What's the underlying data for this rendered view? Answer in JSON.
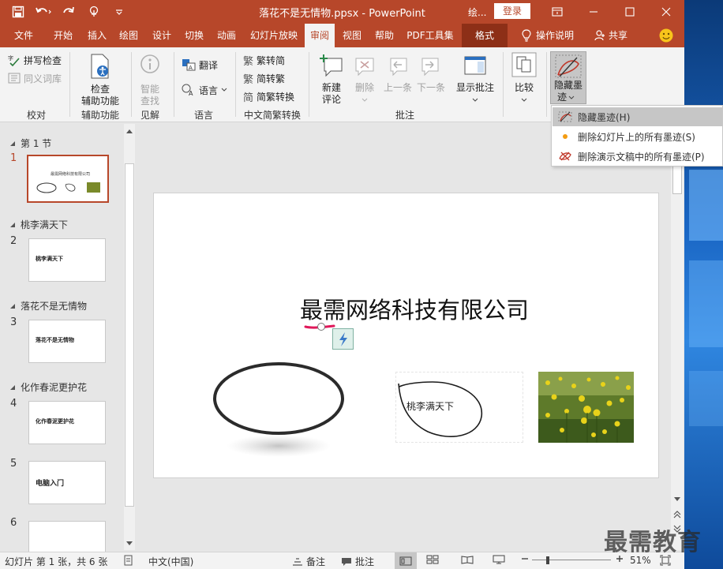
{
  "titlebar": {
    "title": "落花不是无情物.ppsx  -  PowerPoint",
    "draw_short": "绘...",
    "login": "登录"
  },
  "tabs": [
    {
      "label": "文件"
    },
    {
      "label": "开始"
    },
    {
      "label": "插入"
    },
    {
      "label": "绘图"
    },
    {
      "label": "设计"
    },
    {
      "label": "切换"
    },
    {
      "label": "动画"
    },
    {
      "label": "幻灯片放映"
    },
    {
      "label": "审阅"
    },
    {
      "label": "视图"
    },
    {
      "label": "帮助"
    },
    {
      "label": "PDF工具集"
    },
    {
      "label": "格式"
    },
    {
      "label": "操作说明"
    },
    {
      "label": "共享"
    }
  ],
  "ribbon": {
    "proofing": {
      "spell": "拼写检查",
      "thesaurus": "同义词库",
      "label": "校对"
    },
    "accessibility": {
      "check_line1": "检查",
      "check_line2": "辅助功能",
      "label": "辅助功能"
    },
    "insights": {
      "smart_line1": "智能",
      "smart_line2": "查找",
      "label": "见解"
    },
    "language": {
      "translate": "翻译",
      "lang": "语言",
      "label": "语言"
    },
    "chinese": {
      "to_simp": "繁转简",
      "to_trad": "简转繁",
      "convert": "简繁转换",
      "label": "中文简繁转换"
    },
    "comments": {
      "new_line1": "新建",
      "new_line2": "评论",
      "delete": "删除",
      "prev": "上一条",
      "next": "下一条",
      "show": "显示批注",
      "label": "批注"
    },
    "compare": {
      "label": "比较"
    },
    "ink": {
      "line1": "隐藏墨",
      "line2": "迹"
    }
  },
  "dropdown": {
    "items": [
      {
        "label": "隐藏墨迹(H)"
      },
      {
        "label": "删除幻灯片上的所有墨迹(S)"
      },
      {
        "label": "删除演示文稿中的所有墨迹(P)"
      }
    ]
  },
  "thumbs": {
    "sections": [
      {
        "title": "第 1 节"
      },
      {
        "title": "桃李满天下"
      },
      {
        "title": "落花不是无情物"
      },
      {
        "title": "化作春泥更护花"
      }
    ],
    "slides": [
      {
        "num": "1",
        "text": "最需网络科技有限公司"
      },
      {
        "num": "2",
        "text": "桃李满天下"
      },
      {
        "num": "3",
        "text": "落花不是无情物"
      },
      {
        "num": "4",
        "text": "化作春泥更护花"
      },
      {
        "num": "5",
        "text": "电脑入门"
      },
      {
        "num": "6",
        "text": ""
      }
    ]
  },
  "slide": {
    "heading": "最需网络科技有限公司",
    "textbox": "桃李满天下"
  },
  "status": {
    "slide_info": "幻灯片 第 1 张，共 6 张",
    "language": "中文(中国)",
    "notes": "备注",
    "comments": "批注",
    "zoom": "51%"
  },
  "watermark": "最需教育",
  "colors": {
    "accent": "#b7472a",
    "ribbon_bg": "#f3f3f3",
    "selected": "#c6c6c6"
  }
}
